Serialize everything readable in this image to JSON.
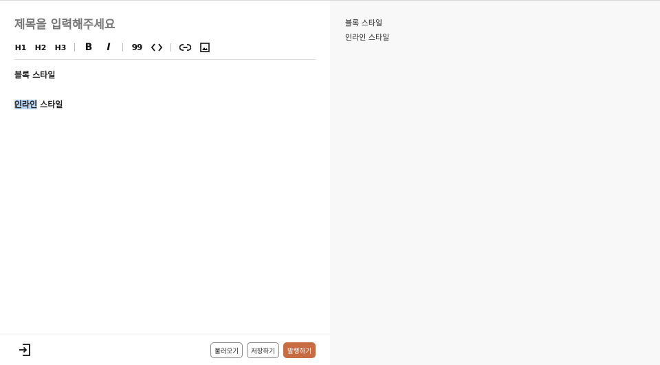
{
  "editor": {
    "title_placeholder": "제목을 입력해주세요",
    "title_value": "",
    "toolbar": {
      "h1": "H1",
      "h2": "H2",
      "h3": "H3",
      "bold": "B",
      "italic": "I",
      "quote": "99"
    },
    "content": {
      "line1": "블록 스타일",
      "line2_selected": "인라인",
      "line2_rest": " 스타일"
    },
    "buttons": {
      "load": "불러오기",
      "save": "저장하기",
      "publish": "발행하기"
    }
  },
  "preview": {
    "lines": [
      "블록 스타일",
      "인라인 스타일"
    ]
  },
  "colors": {
    "publish_button": "#c76b42",
    "selection": "#b6d4f5",
    "preview_background": "#f8f8f8"
  },
  "icons": [
    "h1-icon",
    "h2-icon",
    "h3-icon",
    "bold-icon",
    "italic-icon",
    "quote-icon",
    "code-icon",
    "link-icon",
    "image-icon",
    "exit-icon"
  ]
}
